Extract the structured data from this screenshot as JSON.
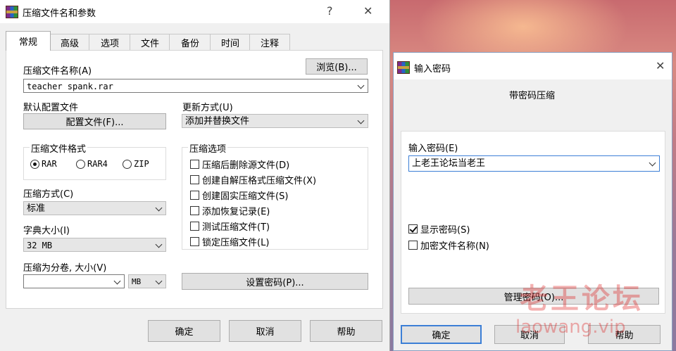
{
  "dialog1": {
    "title": "压缩文件名和参数",
    "help_glyph": "?",
    "close_glyph": "✕",
    "tabs": [
      "常规",
      "高级",
      "选项",
      "文件",
      "备份",
      "时间",
      "注释"
    ],
    "archive_name_label": "压缩文件名称(A)",
    "browse_button": "浏览(B)...",
    "archive_name_value": "teacher spank.rar",
    "default_profile_label": "默认配置文件",
    "profiles_button": "配置文件(F)...",
    "update_mode_label": "更新方式(U)",
    "update_mode_value": "添加并替换文件",
    "format_group_title": "压缩文件格式",
    "formats": [
      {
        "label": "RAR",
        "selected": true
      },
      {
        "label": "RAR4",
        "selected": false
      },
      {
        "label": "ZIP",
        "selected": false
      }
    ],
    "options_group_title": "压缩选项",
    "options": [
      {
        "label": "压缩后删除源文件(D)",
        "checked": false
      },
      {
        "label": "创建自解压格式压缩文件(X)",
        "checked": false
      },
      {
        "label": "创建固实压缩文件(S)",
        "checked": false
      },
      {
        "label": "添加恢复记录(E)",
        "checked": false
      },
      {
        "label": "测试压缩文件(T)",
        "checked": false
      },
      {
        "label": "锁定压缩文件(L)",
        "checked": false
      }
    ],
    "method_label": "压缩方式(C)",
    "method_value": "标准",
    "dict_label": "字典大小(I)",
    "dict_value": "32 MB",
    "split_label": "压缩为分卷, 大小(V)",
    "split_value": "",
    "split_unit": "MB",
    "set_password_button": "设置密码(P)...",
    "ok_button": "确定",
    "cancel_button": "取消",
    "help_button": "帮助"
  },
  "dialog2": {
    "title": "输入密码",
    "close_glyph": "✕",
    "heading": "带密码压缩",
    "password_label": "输入密码(E)",
    "password_value": "上老王论坛当老王",
    "show_password": {
      "label": "显示密码(S)",
      "checked": true
    },
    "encrypt_names": {
      "label": "加密文件名称(N)",
      "checked": false
    },
    "manage_button": "管理密码(O)...",
    "ok_button": "确定",
    "cancel_button": "取消",
    "help_button": "帮助"
  },
  "watermark": {
    "line1": "老王论坛",
    "line2": "laowang.vip"
  }
}
